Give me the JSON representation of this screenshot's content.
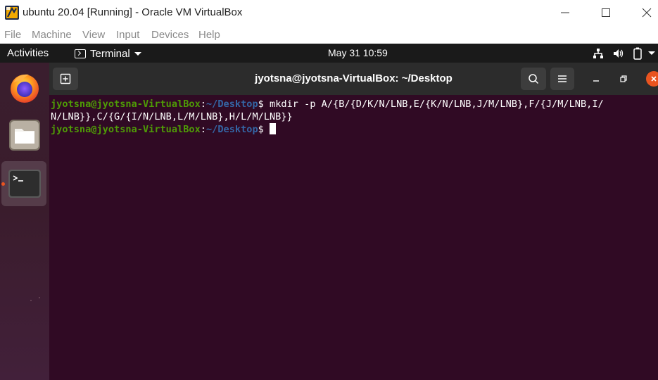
{
  "vbox": {
    "title": "ubuntu 20.04 [Running] - Oracle VM VirtualBox",
    "menu": [
      "File",
      "Machine",
      "View",
      "Input",
      "Devices",
      "Help"
    ]
  },
  "topbar": {
    "activities": "Activities",
    "app_name": "Terminal",
    "clock": "May 31  10:59",
    "tray_icons": [
      "network-icon",
      "volume-icon",
      "battery-icon",
      "power-menu-caret-icon"
    ]
  },
  "dock": {
    "items": [
      "firefox-icon",
      "files-icon",
      "terminal-icon"
    ],
    "active": "terminal-icon"
  },
  "terminal": {
    "title": "jyotsna@jyotsna-VirtualBox: ~/Desktop",
    "lines": [
      {
        "user_host": "jyotsna@jyotsna-VirtualBox",
        "sep": ":",
        "path": "~/Desktop",
        "symbol": "$",
        "command": " mkdir -p A/{B/{D/K/N/LNB,E/{K/N/LNB,J/M/LNB},F/{J/M/LNB,I/"
      },
      {
        "text": "N/LNB}},C/{G/{I/N/LNB,L/M/LNB},H/L/M/LNB}}"
      },
      {
        "user_host": "jyotsna@jyotsna-VirtualBox",
        "sep": ":",
        "path": "~/Desktop",
        "symbol": "$",
        "command": " "
      }
    ]
  },
  "colors": {
    "terminal_bg": "#300a24",
    "prompt_user": "#4e9a06",
    "prompt_path": "#3465a4",
    "ubuntu_orange": "#e95420"
  }
}
